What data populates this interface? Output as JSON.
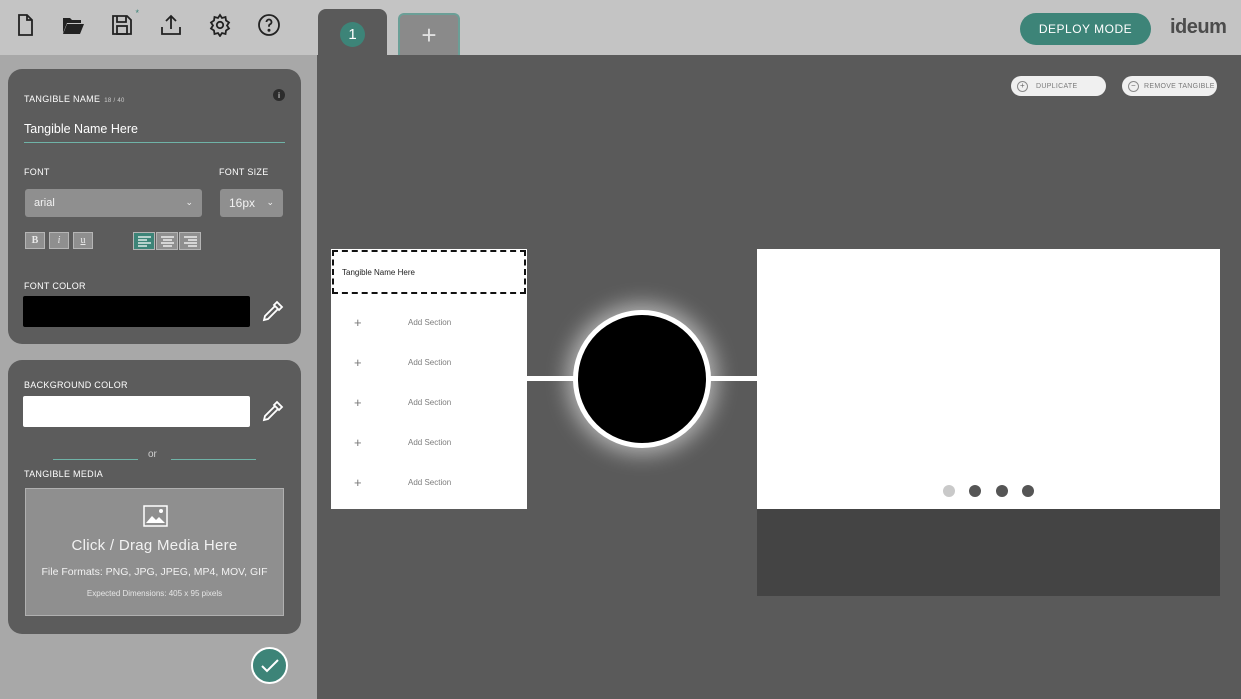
{
  "toolbar": {
    "icons": [
      "new-file-icon",
      "open-folder-icon",
      "save-icon",
      "export-icon",
      "settings-icon",
      "help-icon"
    ]
  },
  "tabs": [
    {
      "label": "1",
      "active": true
    },
    {
      "label": "+",
      "active": false
    }
  ],
  "header": {
    "deploy_label": "DEPLOY MODE",
    "logo_text": "ideum"
  },
  "sidebar": {
    "tangible_name_label": "TANGIBLE NAME",
    "tangible_name_count": "18 / 40",
    "tangible_name_value": "Tangible Name Here",
    "info_glyph": "i",
    "font_label": "FONT",
    "font_value": "arial",
    "font_size_label": "FONT SIZE",
    "font_size_value": "16px",
    "format_buttons": [
      "B",
      "i",
      "u"
    ],
    "alignment": [
      "left",
      "center",
      "right"
    ],
    "active_alignment": "left",
    "font_color_label": "FONT COLOR",
    "font_color": "#000000",
    "background_color_label": "BACKGROUND COLOR",
    "background_color": "#ffffff",
    "or_text": "or",
    "tangible_media_label": "TANGIBLE MEDIA",
    "media_title": "Click / Drag Media Here",
    "media_formats": "File Formats: PNG, JPG, JPEG, MP4, MOV, GIF",
    "media_dims": "Expected Dimensions: 405 x 95 pixels"
  },
  "canvas": {
    "duplicate_label": "DUPLICATE",
    "remove_label": "REMOVE TANGIBLE",
    "menu_title": "Tangible Name Here",
    "add_section_label": "Add Section",
    "section_rows": [
      "Add Section",
      "Add Section",
      "Add Section",
      "Add Section",
      "Add Section"
    ],
    "pagination": {
      "total": 4,
      "current": 1
    }
  },
  "colors": {
    "accent": "#3d8478",
    "topbar": "#c4c4c4",
    "canvas_bg": "#5a5a5a"
  }
}
